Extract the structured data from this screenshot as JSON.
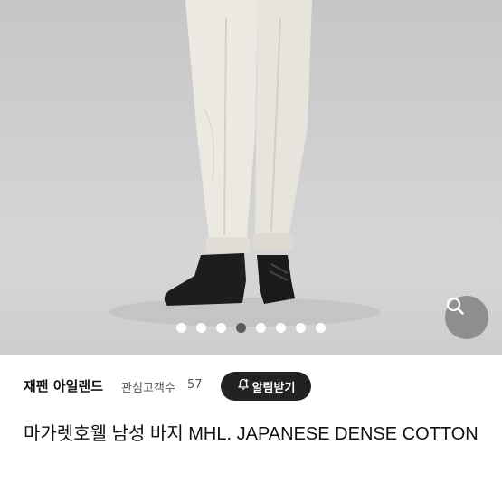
{
  "gallery": {
    "dot_count": 8,
    "active_index": 3
  },
  "icons": {
    "zoom": "search-icon",
    "alert": "bell-plus-icon"
  },
  "seller": {
    "name": "재팬 아일랜드",
    "fan_label": "관심고객수",
    "fan_count": "57",
    "alert_button": "알림받기"
  },
  "product": {
    "title": "마가렛호웰 남성 바지 MHL. JAPANESE DENSE COTTON"
  },
  "colors": {
    "alert_bg": "#222222",
    "active_dot": "#555555"
  }
}
